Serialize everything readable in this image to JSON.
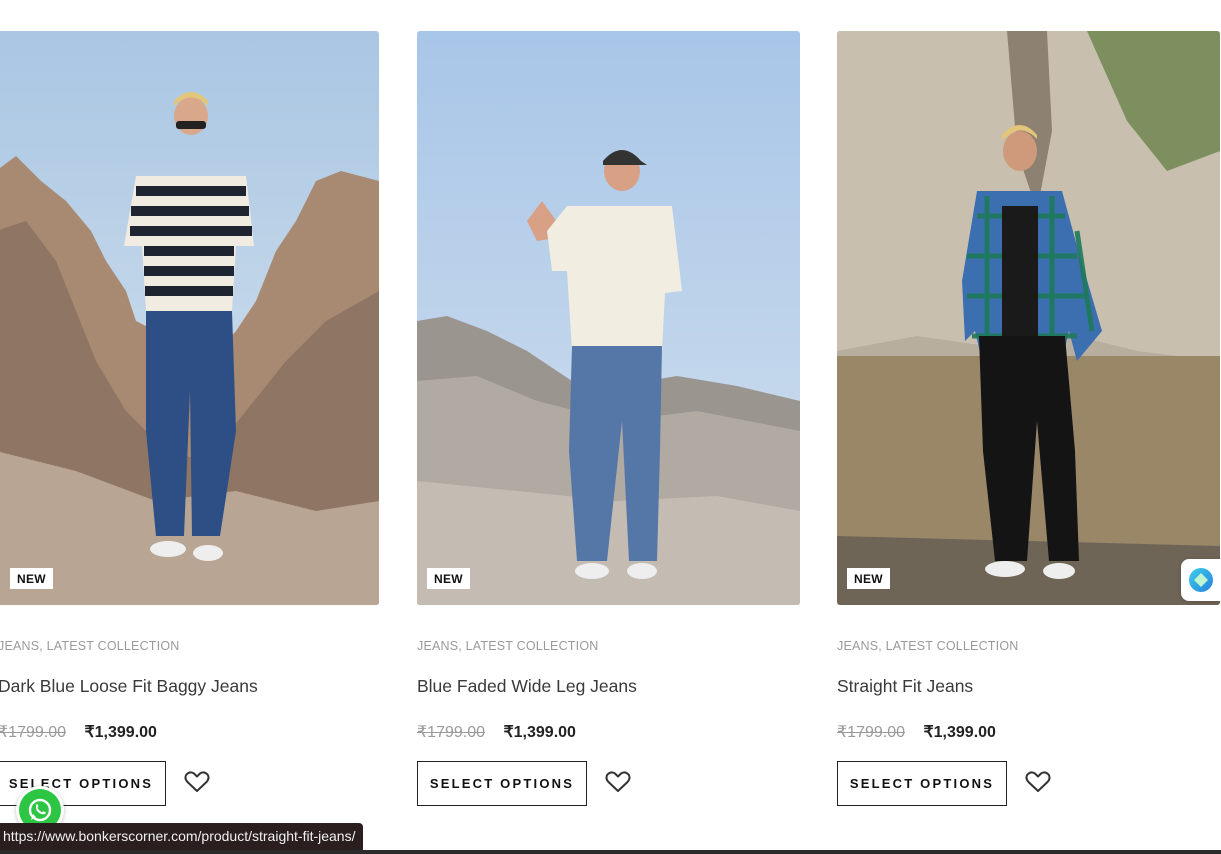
{
  "products": [
    {
      "badge": "NEW",
      "category": "JEANS, LATEST COLLECTION",
      "title": "Dark Blue Loose Fit Baggy Jeans",
      "old_price": "₹1799.00",
      "price": "₹1,399.00",
      "button_label": "SELECT OPTIONS",
      "image_alt": "Model in striped polo and dark blue baggy jeans on rocky terrain"
    },
    {
      "badge": "NEW",
      "category": "JEANS, LATEST COLLECTION",
      "title": "Blue Faded Wide Leg Jeans",
      "old_price": "₹1799.00",
      "price": "₹1,399.00",
      "button_label": "SELECT OPTIONS",
      "image_alt": "Model in white polo and faded wide leg jeans on sand dunes"
    },
    {
      "badge": "NEW",
      "category": "JEANS, LATEST COLLECTION",
      "title": "Straight Fit Jeans",
      "old_price": "₹1799.00",
      "price": "₹1,399.00",
      "button_label": "SELECT OPTIONS",
      "image_alt": "Model in plaid shirt and black straight fit jeans by a lake"
    }
  ],
  "status_bar": {
    "url": "https://www.bonkerscorner.com/product/straight-fit-jeans/"
  },
  "icons": {
    "wishlist": "heart-icon",
    "whatsapp": "whatsapp-icon",
    "chat": "chat-widget-icon"
  },
  "colors": {
    "badge_bg": "#ffffff",
    "old_price": "#9a9a9a",
    "whatsapp": "#2cc644",
    "status_bar_bg": "#2b1e1e"
  }
}
